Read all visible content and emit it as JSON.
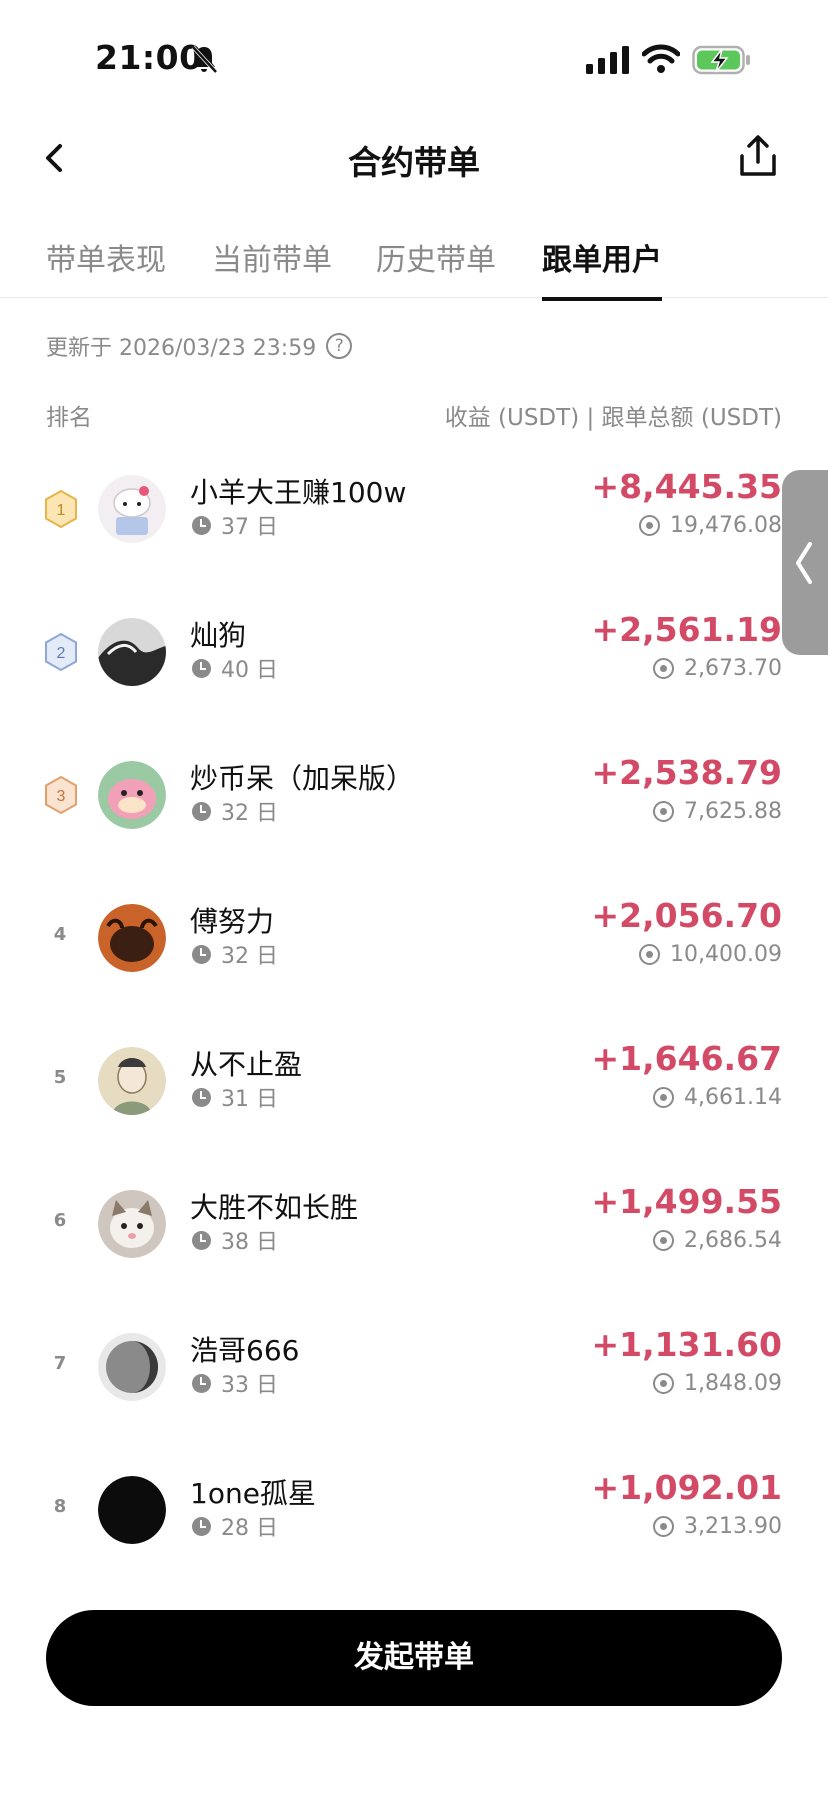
{
  "status_bar": {
    "time": "21:00"
  },
  "header": {
    "title": "合约带单"
  },
  "tabs": [
    {
      "label": "带单表现",
      "active": false
    },
    {
      "label": "当前带单",
      "active": false
    },
    {
      "label": "历史带单",
      "active": false
    },
    {
      "label": "跟单用户",
      "active": true
    }
  ],
  "meta": {
    "updated": "更新于 2026/03/23 23:59",
    "col_rank": "排名",
    "col_metrics": "收益 (USDT) | 跟单总额 (USDT)"
  },
  "users": [
    {
      "rank": "1",
      "name": "小羊大王赚100w",
      "days": "37 日",
      "profit": "+8,445.35",
      "total": "19,476.08"
    },
    {
      "rank": "2",
      "name": "灿狗",
      "days": "40 日",
      "profit": "+2,561.19",
      "total": "2,673.70"
    },
    {
      "rank": "3",
      "name": "炒币呆（加呆版）",
      "days": "32 日",
      "profit": "+2,538.79",
      "total": "7,625.88"
    },
    {
      "rank": "4",
      "name": "傅努力",
      "days": "32 日",
      "profit": "+2,056.70",
      "total": "10,400.09"
    },
    {
      "rank": "5",
      "name": "从不止盈",
      "days": "31 日",
      "profit": "+1,646.67",
      "total": "4,661.14"
    },
    {
      "rank": "6",
      "name": "大胜不如长胜",
      "days": "38 日",
      "profit": "+1,499.55",
      "total": "2,686.54"
    },
    {
      "rank": "7",
      "name": "浩哥666",
      "days": "33 日",
      "profit": "+1,131.60",
      "total": "1,848.09"
    },
    {
      "rank": "8",
      "name": "1one孤星",
      "days": "28 日",
      "profit": "+1,092.01",
      "total": "3,213.90"
    }
  ],
  "cta": {
    "label": "发起带单"
  },
  "colors": {
    "profit": "#d24a66",
    "gold": "#e8b44a",
    "silver": "#8fa6d6",
    "bronze": "#e3a06c"
  }
}
